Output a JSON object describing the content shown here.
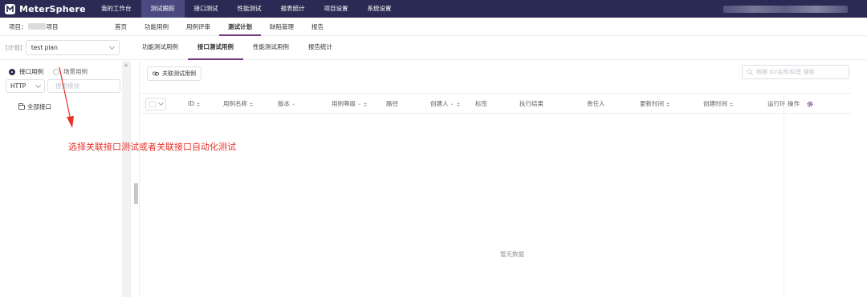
{
  "topbar": {
    "app_name": "MeterSphere",
    "nav": [
      "我的工作台",
      "测试跟踪",
      "接口测试",
      "性能测试",
      "报表统计",
      "项目设置",
      "系统设置"
    ],
    "active_nav": "测试跟踪"
  },
  "subbar": {
    "project_prefix": "项目：",
    "project_suffix": "项目",
    "nav": [
      "首页",
      "功能用例",
      "用例评审",
      "测试计划",
      "缺陷管理",
      "报告"
    ],
    "active_nav": "测试计划"
  },
  "planbar": {
    "label": "[计划]",
    "plan_selected": "test plan",
    "tabs": [
      "功能测试用例",
      "接口测试用例",
      "性能测试用例",
      "报告统计"
    ],
    "active_tab": "接口测试用例"
  },
  "left": {
    "radio_api": "接口用例",
    "radio_scenario": "场景用例",
    "protocol": "HTTP",
    "module_placeholder": "搜索模块",
    "tree_root": "全部接口"
  },
  "right": {
    "associate_button": "关联测试用例",
    "search_placeholder": "根据 ID/名称/标签 搜索",
    "columns": {
      "id": "ID",
      "name": "用例名称",
      "version": "版本",
      "priority": "用例等级",
      "path": "路径",
      "creator": "创建人",
      "tags": "标签",
      "result": "执行结果",
      "owner": "责任人",
      "updated": "更新时间",
      "created": "创建时间",
      "run_env": "运行环",
      "actions": "操作"
    },
    "empty": "暂无数据"
  },
  "annotation": {
    "text": "选择关联接口测试或者关联接口自动化测试",
    "color": "#e8312a"
  },
  "colors": {
    "topbar": "#2b2a54",
    "accent": "#783887"
  }
}
